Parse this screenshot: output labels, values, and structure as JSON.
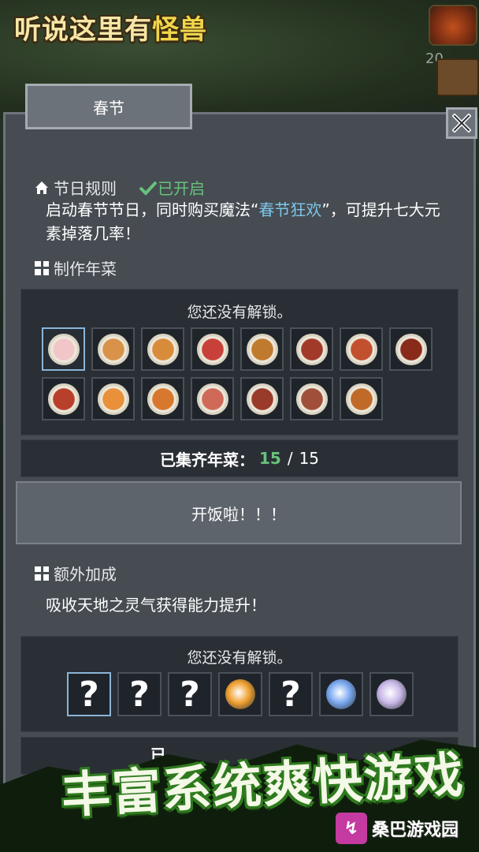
{
  "game": {
    "logo_part1": "听说这里有",
    "logo_part2": "怪兽"
  },
  "top_items": {
    "count": "20"
  },
  "tab": {
    "label": "春节"
  },
  "close": {
    "icon": "close-x-icon"
  },
  "rules": {
    "title": "节日规则",
    "status": "已开启",
    "desc_pre": "启动春节节日，同时购买魔法“",
    "magic_name": "春节狂欢",
    "desc_post": "”，可提升七大元素掉落几率！"
  },
  "recipes": {
    "title": "制作年菜",
    "locked_msg": "您还没有解锁。",
    "dish_colors": [
      [
        "#f2c6c8",
        "#d8924a",
        "#d88c3a",
        "#c8403a",
        "#c07a2e",
        "#a23a2a",
        "#c2502e",
        "#8a2a1a"
      ],
      [
        "#b8402a",
        "#e8903a",
        "#d8782e",
        "#d06a58",
        "#9a3a2a",
        "#a0503a",
        "#c06a2a"
      ]
    ],
    "collected_label": "已集齐年菜：",
    "collected": "15",
    "sep": "/",
    "total": "15",
    "meal_button": "开饭啦！！！"
  },
  "bonus": {
    "title": "额外加成",
    "desc": "吸收天地之灵气获得能力提升！",
    "locked_msg": "您还没有解锁。",
    "slots": [
      {
        "type": "q",
        "text": "?"
      },
      {
        "type": "q",
        "text": "?"
      },
      {
        "type": "q",
        "text": "?"
      },
      {
        "type": "orb",
        "color": "#f0a030"
      },
      {
        "type": "q",
        "text": "?"
      },
      {
        "type": "orb",
        "color": "#7aa8f0"
      },
      {
        "type": "orb",
        "color": "#c8b8e8"
      }
    ],
    "partial_label": "已"
  },
  "banner": {
    "text": "丰富系统爽快游戏"
  },
  "watermark": {
    "text": "桑巴游戏园"
  }
}
